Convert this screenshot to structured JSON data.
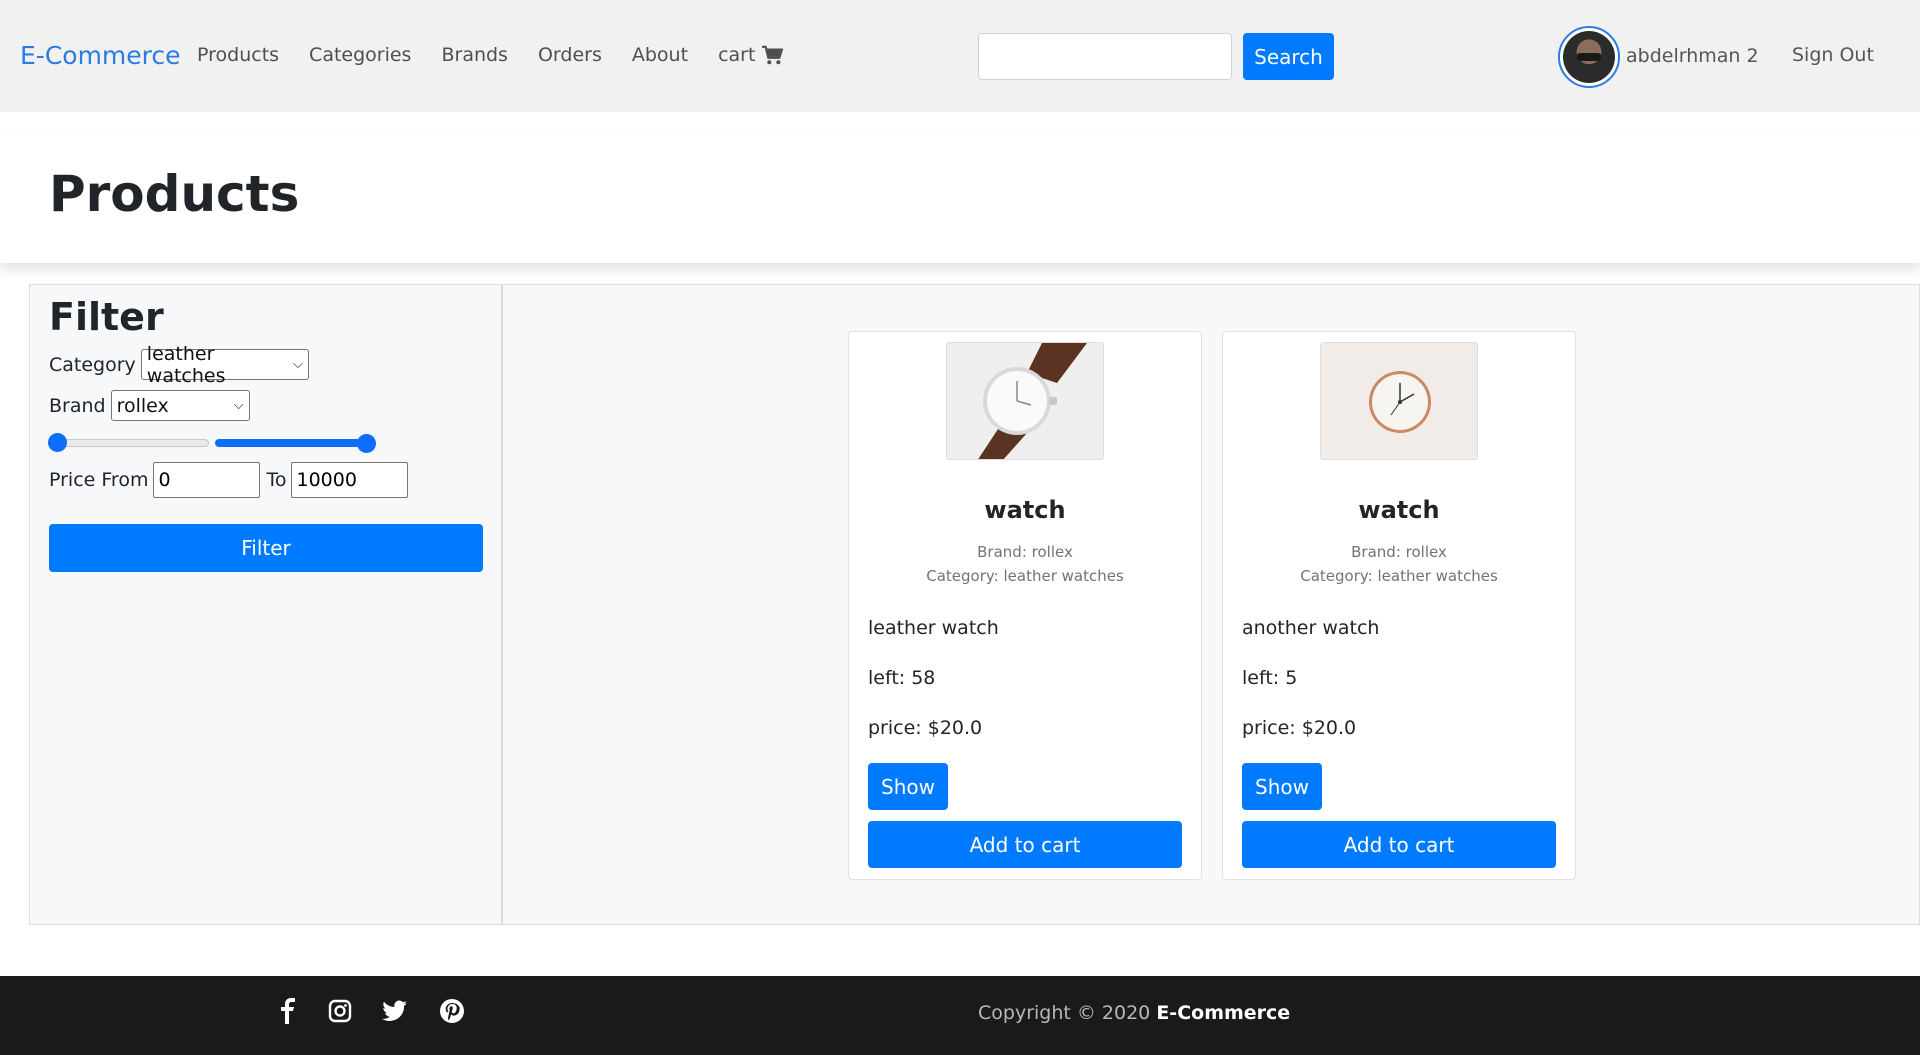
{
  "navbar": {
    "brand": "E-Commerce",
    "links": [
      "Products",
      "Categories",
      "Brands",
      "Orders",
      "About"
    ],
    "cart_label": "cart",
    "search_button": "Search",
    "search_value": "",
    "username": "abdelrhman 2",
    "signout": "Sign Out"
  },
  "header": {
    "title": "Products"
  },
  "filter": {
    "title": "Filter",
    "category_label": "Category",
    "category_value": "leather watches",
    "brand_label": "Brand",
    "brand_value": "rollex",
    "price_from_label": "Price From",
    "price_from_value": "0",
    "price_to_label": "To",
    "price_to_value": "10000",
    "button": "Filter",
    "slider_min_fraction": 0.0,
    "slider_max_fraction": 1.0
  },
  "products": [
    {
      "name": "watch",
      "brand": "Brand: rollex",
      "category": "Category: leather watches",
      "description": "leather watch",
      "left": "left: 58",
      "price": "price: $20.0",
      "show": "Show",
      "add": "Add to cart",
      "image_icon": "wristwatch-image"
    },
    {
      "name": "watch",
      "brand": "Brand: rollex",
      "category": "Category: leather watches",
      "description": "another watch",
      "left": "left: 5",
      "price": "price: $20.0",
      "show": "Show",
      "add": "Add to cart",
      "image_icon": "clock-image"
    }
  ],
  "footer": {
    "copyright_prefix": "Copyright © 2020",
    "copyright_brand": "E-Commerce",
    "social_icons": [
      "facebook-icon",
      "instagram-icon",
      "twitter-icon",
      "pinterest-icon"
    ]
  },
  "colors": {
    "primary": "#007bff",
    "brand": "#2c7be5",
    "footer_bg": "#1a1a1a"
  }
}
